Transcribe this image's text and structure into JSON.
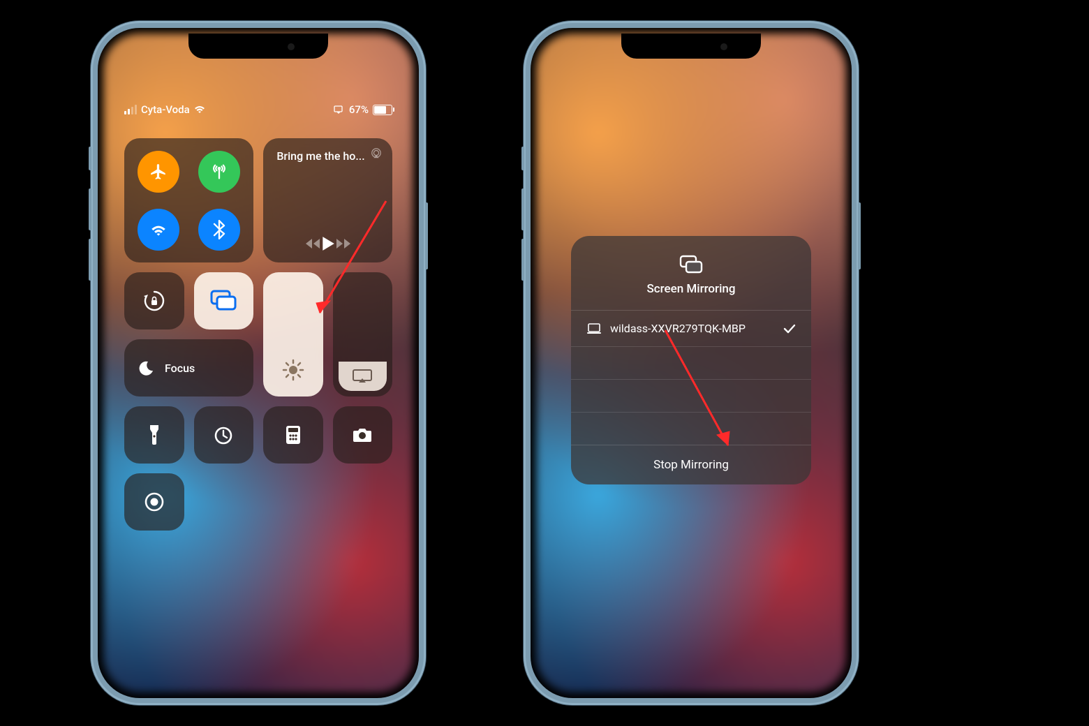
{
  "phone1": {
    "status": {
      "carrier": "Cyta-Voda",
      "battery_pct": "67%"
    },
    "music": {
      "title": "Bring me the ho..."
    },
    "focus": {
      "label": "Focus"
    }
  },
  "phone2": {
    "panel": {
      "header": "Screen Mirroring",
      "device": "wildass-XXVR279TQK-MBP",
      "stop": "Stop Mirroring"
    }
  },
  "colors": {
    "accent_blue": "#0b84ff",
    "accent_orange": "#ff9500",
    "accent_green": "#34c759",
    "arrow": "#ff2a2a"
  }
}
